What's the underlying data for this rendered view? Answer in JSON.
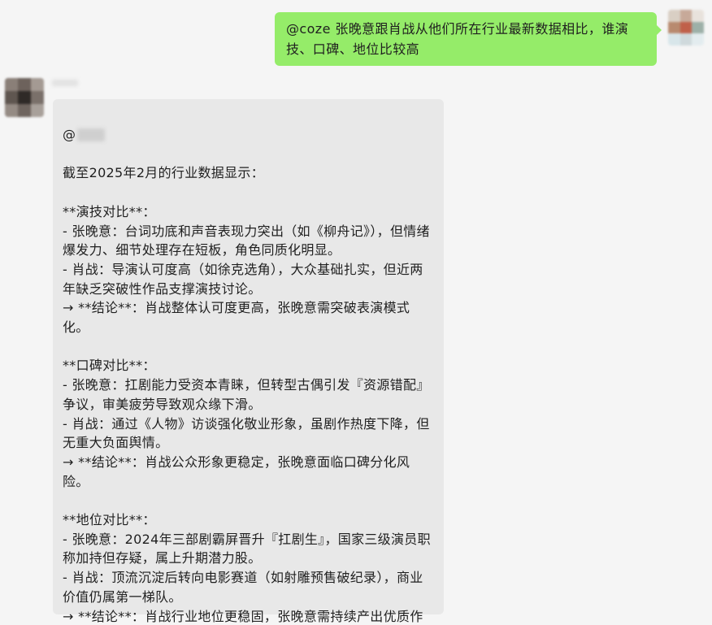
{
  "outgoing_message": {
    "text": "@coze 张晚意跟肖战从他们所在行业最新数据相比，谁演技、口碑、地位比较高"
  },
  "incoming_message": {
    "mention_prefix": "@",
    "lines": [
      "截至2025年2月的行业数据显示：",
      "",
      "**演技对比**：",
      "- 张晚意：台词功底和声音表现力突出（如《柳舟记》），但情绪爆发力、细节处理存在短板，角色同质化明显。",
      "- 肖战：导演认可度高（如徐克选角），大众基础扎实，但近两年缺乏突破性作品支撑演技讨论。",
      "→ **结论**：肖战整体认可度更高，张晚意需突破表演模式化。",
      "",
      "**口碑对比**：",
      "- 张晚意：扛剧能力受资本青睐，但转型古偶引发『资源错配』争议，审美疲劳导致观众缘下滑。",
      "- 肖战：通过《人物》访谈强化敬业形象，虽剧作热度下降，但无重大负面舆情。",
      "→ **结论**：肖战公众形象更稳定，张晚意面临口碑分化风险。",
      "",
      "**地位对比**：",
      "- 张晚意：2024年三部剧霸屏晋升『扛剧生』，国家三级演员职称加持但存疑，属上升期潜力股。",
      "- 肖战：顶流沉淀后转向电影赛道（如射雕预售破纪录），商业价值仍属第一梯队。",
      "→ **结论**：肖战行业地位更稳固，张晚意需持续产出优质作品证明实力。"
    ]
  },
  "avatars": {
    "self": {
      "icon": "user-avatar-pixelated",
      "colors": [
        "#d9cfc4",
        "#c7a999",
        "#e8e2dc",
        "#b88a6f",
        "#c0604a",
        "#9db0a8",
        "#d8e6ea",
        "#cfd9dc",
        "#e3ecef"
      ]
    },
    "bot": {
      "icon": "bot-avatar-pixelated",
      "colors": [
        "#8a7f78",
        "#6d625c",
        "#a49a93",
        "#5f5650",
        "#2f2a27",
        "#7a706a",
        "#958b84",
        "#6f655f",
        "#a8a09a"
      ]
    }
  },
  "colors": {
    "background": "#f5f5f5",
    "outgoing_bubble": "#95ec69",
    "incoming_bubble": "#e8e8e8",
    "text": "#1f1f1f"
  }
}
